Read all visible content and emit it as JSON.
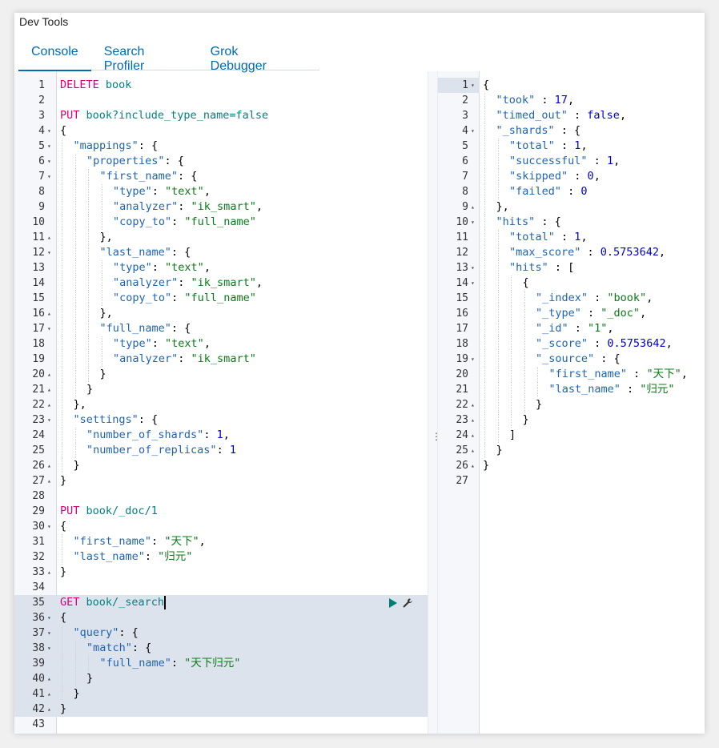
{
  "app": {
    "title": "Dev Tools"
  },
  "tabs": [
    {
      "label": "Console",
      "active": true
    },
    {
      "label": "Search Profiler",
      "active": false
    },
    {
      "label": "Grok Debugger",
      "active": false
    }
  ],
  "colors": {
    "method": "#d6007a",
    "url": "#00827f",
    "key": "#1f63b5",
    "string": "#0a7b18",
    "number": "#0000d6",
    "accent": "#006bb4"
  },
  "icons": {
    "run": "play-icon",
    "settings": "wrench-icon",
    "resize": "vertical-dots-icon"
  },
  "request": {
    "active_line": 35,
    "highlight_start": 35,
    "highlight_end": 42,
    "lines": [
      {
        "n": 1,
        "fold": "",
        "indent": 0,
        "tokens": [
          [
            "method",
            "DELETE"
          ],
          [
            "url",
            " book"
          ]
        ]
      },
      {
        "n": 2,
        "fold": "",
        "indent": 0,
        "tokens": []
      },
      {
        "n": 3,
        "fold": "",
        "indent": 0,
        "tokens": [
          [
            "method",
            "PUT"
          ],
          [
            "url",
            " book?include_type_name=false"
          ]
        ]
      },
      {
        "n": 4,
        "fold": "▾",
        "indent": 0,
        "tokens": [
          [
            "punc",
            "{"
          ]
        ]
      },
      {
        "n": 5,
        "fold": "▾",
        "indent": 1,
        "tokens": [
          [
            "key",
            "\"mappings\""
          ],
          [
            "punc",
            ": {"
          ]
        ]
      },
      {
        "n": 6,
        "fold": "▾",
        "indent": 2,
        "tokens": [
          [
            "key",
            "\"properties\""
          ],
          [
            "punc",
            ": {"
          ]
        ]
      },
      {
        "n": 7,
        "fold": "▾",
        "indent": 3,
        "tokens": [
          [
            "key",
            "\"first_name\""
          ],
          [
            "punc",
            ": {"
          ]
        ]
      },
      {
        "n": 8,
        "fold": "",
        "indent": 4,
        "tokens": [
          [
            "key",
            "\"type\""
          ],
          [
            "punc",
            ": "
          ],
          [
            "str",
            "\"text\""
          ],
          [
            "punc",
            ","
          ]
        ]
      },
      {
        "n": 9,
        "fold": "",
        "indent": 4,
        "tokens": [
          [
            "key",
            "\"analyzer\""
          ],
          [
            "punc",
            ": "
          ],
          [
            "str",
            "\"ik_smart\""
          ],
          [
            "punc",
            ","
          ]
        ]
      },
      {
        "n": 10,
        "fold": "",
        "indent": 4,
        "tokens": [
          [
            "key",
            "\"copy_to\""
          ],
          [
            "punc",
            ": "
          ],
          [
            "str",
            "\"full_name\""
          ]
        ]
      },
      {
        "n": 11,
        "fold": "▴",
        "indent": 3,
        "tokens": [
          [
            "punc",
            "},"
          ]
        ]
      },
      {
        "n": 12,
        "fold": "▾",
        "indent": 3,
        "tokens": [
          [
            "key",
            "\"last_name\""
          ],
          [
            "punc",
            ": {"
          ]
        ]
      },
      {
        "n": 13,
        "fold": "",
        "indent": 4,
        "tokens": [
          [
            "key",
            "\"type\""
          ],
          [
            "punc",
            ": "
          ],
          [
            "str",
            "\"text\""
          ],
          [
            "punc",
            ","
          ]
        ]
      },
      {
        "n": 14,
        "fold": "",
        "indent": 4,
        "tokens": [
          [
            "key",
            "\"analyzer\""
          ],
          [
            "punc",
            ": "
          ],
          [
            "str",
            "\"ik_smart\""
          ],
          [
            "punc",
            ","
          ]
        ]
      },
      {
        "n": 15,
        "fold": "",
        "indent": 4,
        "tokens": [
          [
            "key",
            "\"copy_to\""
          ],
          [
            "punc",
            ": "
          ],
          [
            "str",
            "\"full_name\""
          ]
        ]
      },
      {
        "n": 16,
        "fold": "▴",
        "indent": 3,
        "tokens": [
          [
            "punc",
            "},"
          ]
        ]
      },
      {
        "n": 17,
        "fold": "▾",
        "indent": 3,
        "tokens": [
          [
            "key",
            "\"full_name\""
          ],
          [
            "punc",
            ": {"
          ]
        ]
      },
      {
        "n": 18,
        "fold": "",
        "indent": 4,
        "tokens": [
          [
            "key",
            "\"type\""
          ],
          [
            "punc",
            ": "
          ],
          [
            "str",
            "\"text\""
          ],
          [
            "punc",
            ","
          ]
        ]
      },
      {
        "n": 19,
        "fold": "",
        "indent": 4,
        "tokens": [
          [
            "key",
            "\"analyzer\""
          ],
          [
            "punc",
            ": "
          ],
          [
            "str",
            "\"ik_smart\""
          ]
        ]
      },
      {
        "n": 20,
        "fold": "▴",
        "indent": 3,
        "tokens": [
          [
            "punc",
            "}"
          ]
        ]
      },
      {
        "n": 21,
        "fold": "▴",
        "indent": 2,
        "tokens": [
          [
            "punc",
            "}"
          ]
        ]
      },
      {
        "n": 22,
        "fold": "▴",
        "indent": 1,
        "tokens": [
          [
            "punc",
            "},"
          ]
        ]
      },
      {
        "n": 23,
        "fold": "▾",
        "indent": 1,
        "tokens": [
          [
            "key",
            "\"settings\""
          ],
          [
            "punc",
            ": {"
          ]
        ]
      },
      {
        "n": 24,
        "fold": "",
        "indent": 2,
        "tokens": [
          [
            "key",
            "\"number_of_shards\""
          ],
          [
            "punc",
            ": "
          ],
          [
            "num",
            "1"
          ],
          [
            "punc",
            ","
          ]
        ]
      },
      {
        "n": 25,
        "fold": "",
        "indent": 2,
        "tokens": [
          [
            "key",
            "\"number_of_replicas\""
          ],
          [
            "punc",
            ": "
          ],
          [
            "num",
            "1"
          ]
        ]
      },
      {
        "n": 26,
        "fold": "▴",
        "indent": 1,
        "tokens": [
          [
            "punc",
            "}"
          ]
        ]
      },
      {
        "n": 27,
        "fold": "▴",
        "indent": 0,
        "tokens": [
          [
            "punc",
            "}"
          ]
        ]
      },
      {
        "n": 28,
        "fold": "",
        "indent": 0,
        "tokens": []
      },
      {
        "n": 29,
        "fold": "",
        "indent": 0,
        "tokens": [
          [
            "method",
            "PUT"
          ],
          [
            "url",
            " book/_doc/1"
          ]
        ]
      },
      {
        "n": 30,
        "fold": "▾",
        "indent": 0,
        "tokens": [
          [
            "punc",
            "{"
          ]
        ]
      },
      {
        "n": 31,
        "fold": "",
        "indent": 1,
        "tokens": [
          [
            "key",
            "\"first_name\""
          ],
          [
            "punc",
            ": "
          ],
          [
            "str",
            "\"天下\""
          ],
          [
            "punc",
            ","
          ]
        ]
      },
      {
        "n": 32,
        "fold": "",
        "indent": 1,
        "tokens": [
          [
            "key",
            "\"last_name\""
          ],
          [
            "punc",
            ": "
          ],
          [
            "str",
            "\"归元\""
          ]
        ]
      },
      {
        "n": 33,
        "fold": "▴",
        "indent": 0,
        "tokens": [
          [
            "punc",
            "}"
          ]
        ]
      },
      {
        "n": 34,
        "fold": "",
        "indent": 0,
        "tokens": []
      },
      {
        "n": 35,
        "fold": "",
        "indent": 0,
        "tokens": [
          [
            "method",
            "GET"
          ],
          [
            "url",
            " book/_search"
          ]
        ]
      },
      {
        "n": 36,
        "fold": "▾",
        "indent": 0,
        "tokens": [
          [
            "punc",
            "{"
          ]
        ]
      },
      {
        "n": 37,
        "fold": "▾",
        "indent": 1,
        "tokens": [
          [
            "key",
            "\"query\""
          ],
          [
            "punc",
            ": {"
          ]
        ]
      },
      {
        "n": 38,
        "fold": "▾",
        "indent": 2,
        "tokens": [
          [
            "key",
            "\"match\""
          ],
          [
            "punc",
            ": {"
          ]
        ]
      },
      {
        "n": 39,
        "fold": "",
        "indent": 3,
        "tokens": [
          [
            "key",
            "\"full_name\""
          ],
          [
            "punc",
            ": "
          ],
          [
            "str",
            "\"天下归元\""
          ]
        ]
      },
      {
        "n": 40,
        "fold": "▴",
        "indent": 2,
        "tokens": [
          [
            "punc",
            "}"
          ]
        ]
      },
      {
        "n": 41,
        "fold": "▴",
        "indent": 1,
        "tokens": [
          [
            "punc",
            "}"
          ]
        ]
      },
      {
        "n": 42,
        "fold": "▴",
        "indent": 0,
        "tokens": [
          [
            "punc",
            "}"
          ]
        ]
      },
      {
        "n": 43,
        "fold": "",
        "indent": 0,
        "tokens": []
      }
    ]
  },
  "response": {
    "active_line": 1,
    "lines": [
      {
        "n": 1,
        "fold": "▾",
        "indent": 0,
        "tokens": [
          [
            "punc",
            "{"
          ]
        ]
      },
      {
        "n": 2,
        "fold": "",
        "indent": 1,
        "tokens": [
          [
            "key",
            "\"took\""
          ],
          [
            "punc",
            " : "
          ],
          [
            "num",
            "17"
          ],
          [
            "punc",
            ","
          ]
        ]
      },
      {
        "n": 3,
        "fold": "",
        "indent": 1,
        "tokens": [
          [
            "key",
            "\"timed_out\""
          ],
          [
            "punc",
            " : "
          ],
          [
            "bool",
            "false"
          ],
          [
            "punc",
            ","
          ]
        ]
      },
      {
        "n": 4,
        "fold": "▾",
        "indent": 1,
        "tokens": [
          [
            "key",
            "\"_shards\""
          ],
          [
            "punc",
            " : {"
          ]
        ]
      },
      {
        "n": 5,
        "fold": "",
        "indent": 2,
        "tokens": [
          [
            "key",
            "\"total\""
          ],
          [
            "punc",
            " : "
          ],
          [
            "num",
            "1"
          ],
          [
            "punc",
            ","
          ]
        ]
      },
      {
        "n": 6,
        "fold": "",
        "indent": 2,
        "tokens": [
          [
            "key",
            "\"successful\""
          ],
          [
            "punc",
            " : "
          ],
          [
            "num",
            "1"
          ],
          [
            "punc",
            ","
          ]
        ]
      },
      {
        "n": 7,
        "fold": "",
        "indent": 2,
        "tokens": [
          [
            "key",
            "\"skipped\""
          ],
          [
            "punc",
            " : "
          ],
          [
            "num",
            "0"
          ],
          [
            "punc",
            ","
          ]
        ]
      },
      {
        "n": 8,
        "fold": "",
        "indent": 2,
        "tokens": [
          [
            "key",
            "\"failed\""
          ],
          [
            "punc",
            " : "
          ],
          [
            "num",
            "0"
          ]
        ]
      },
      {
        "n": 9,
        "fold": "▴",
        "indent": 1,
        "tokens": [
          [
            "punc",
            "},"
          ]
        ]
      },
      {
        "n": 10,
        "fold": "▾",
        "indent": 1,
        "tokens": [
          [
            "key",
            "\"hits\""
          ],
          [
            "punc",
            " : {"
          ]
        ]
      },
      {
        "n": 11,
        "fold": "",
        "indent": 2,
        "tokens": [
          [
            "key",
            "\"total\""
          ],
          [
            "punc",
            " : "
          ],
          [
            "num",
            "1"
          ],
          [
            "punc",
            ","
          ]
        ]
      },
      {
        "n": 12,
        "fold": "",
        "indent": 2,
        "tokens": [
          [
            "key",
            "\"max_score\""
          ],
          [
            "punc",
            " : "
          ],
          [
            "num",
            "0.5753642"
          ],
          [
            "punc",
            ","
          ]
        ]
      },
      {
        "n": 13,
        "fold": "▾",
        "indent": 2,
        "tokens": [
          [
            "key",
            "\"hits\""
          ],
          [
            "punc",
            " : ["
          ]
        ]
      },
      {
        "n": 14,
        "fold": "▾",
        "indent": 3,
        "tokens": [
          [
            "punc",
            "{"
          ]
        ]
      },
      {
        "n": 15,
        "fold": "",
        "indent": 4,
        "tokens": [
          [
            "key",
            "\"_index\""
          ],
          [
            "punc",
            " : "
          ],
          [
            "str",
            "\"book\""
          ],
          [
            "punc",
            ","
          ]
        ]
      },
      {
        "n": 16,
        "fold": "",
        "indent": 4,
        "tokens": [
          [
            "key",
            "\"_type\""
          ],
          [
            "punc",
            " : "
          ],
          [
            "str",
            "\"_doc\""
          ],
          [
            "punc",
            ","
          ]
        ]
      },
      {
        "n": 17,
        "fold": "",
        "indent": 4,
        "tokens": [
          [
            "key",
            "\"_id\""
          ],
          [
            "punc",
            " : "
          ],
          [
            "str",
            "\"1\""
          ],
          [
            "punc",
            ","
          ]
        ]
      },
      {
        "n": 18,
        "fold": "",
        "indent": 4,
        "tokens": [
          [
            "key",
            "\"_score\""
          ],
          [
            "punc",
            " : "
          ],
          [
            "num",
            "0.5753642"
          ],
          [
            "punc",
            ","
          ]
        ]
      },
      {
        "n": 19,
        "fold": "▾",
        "indent": 4,
        "tokens": [
          [
            "key",
            "\"_source\""
          ],
          [
            "punc",
            " : {"
          ]
        ]
      },
      {
        "n": 20,
        "fold": "",
        "indent": 5,
        "tokens": [
          [
            "key",
            "\"first_name\""
          ],
          [
            "punc",
            " : "
          ],
          [
            "str",
            "\"天下\""
          ],
          [
            "punc",
            ","
          ]
        ]
      },
      {
        "n": 21,
        "fold": "",
        "indent": 5,
        "tokens": [
          [
            "key",
            "\"last_name\""
          ],
          [
            "punc",
            " : "
          ],
          [
            "str",
            "\"归元\""
          ]
        ]
      },
      {
        "n": 22,
        "fold": "▴",
        "indent": 4,
        "tokens": [
          [
            "punc",
            "}"
          ]
        ]
      },
      {
        "n": 23,
        "fold": "▴",
        "indent": 3,
        "tokens": [
          [
            "punc",
            "}"
          ]
        ]
      },
      {
        "n": 24,
        "fold": "▴",
        "indent": 2,
        "tokens": [
          [
            "punc",
            "]"
          ]
        ]
      },
      {
        "n": 25,
        "fold": "▴",
        "indent": 1,
        "tokens": [
          [
            "punc",
            "}"
          ]
        ]
      },
      {
        "n": 26,
        "fold": "▴",
        "indent": 0,
        "tokens": [
          [
            "punc",
            "}"
          ]
        ]
      },
      {
        "n": 27,
        "fold": "",
        "indent": 0,
        "tokens": []
      }
    ]
  }
}
